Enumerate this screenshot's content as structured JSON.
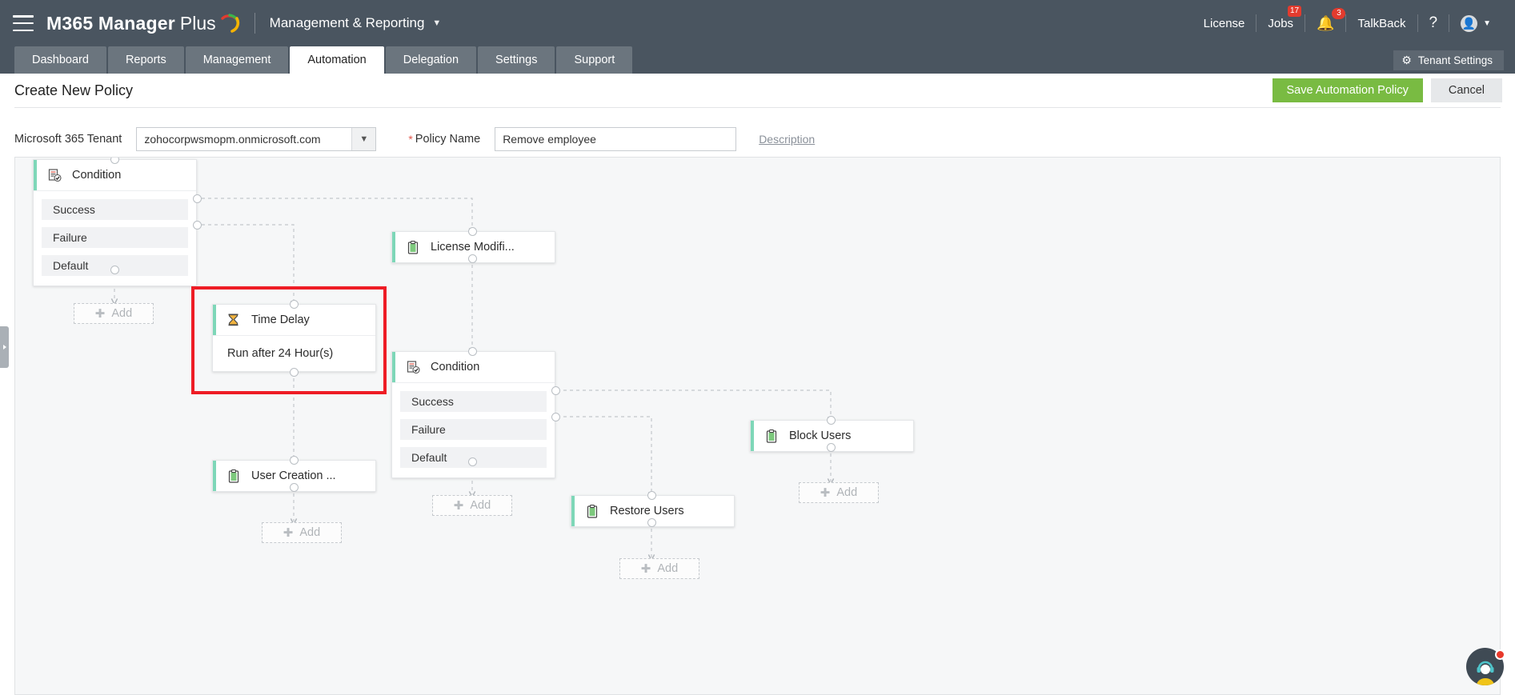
{
  "header": {
    "brand_bold": "M365 Manager",
    "brand_light": "Plus",
    "mode_selector": "Management & Reporting",
    "license": "License",
    "jobs": "Jobs",
    "jobs_badge": "17",
    "notifications_badge": "3",
    "talkback": "TalkBack",
    "help": "?",
    "menu_icon": "hamburger-icon",
    "bell_icon": "bell-icon",
    "user_icon": "user-avatar-icon"
  },
  "tabs": [
    {
      "label": "Dashboard",
      "active": false
    },
    {
      "label": "Reports",
      "active": false
    },
    {
      "label": "Management",
      "active": false
    },
    {
      "label": "Automation",
      "active": true
    },
    {
      "label": "Delegation",
      "active": false
    },
    {
      "label": "Settings",
      "active": false
    },
    {
      "label": "Support",
      "active": false
    }
  ],
  "tenant_settings": {
    "label": "Tenant Settings",
    "icon": "gear-icon"
  },
  "toolbar": {
    "page_title": "Create New Policy",
    "save_label": "Save Automation Policy",
    "cancel_label": "Cancel",
    "save_color": "#79bb42"
  },
  "form": {
    "tenant_label": "Microsoft 365 Tenant",
    "tenant_value": "zohocorpwsmopm.onmicrosoft.com",
    "required_mark": "*",
    "policy_name_label": "Policy Name",
    "policy_name_value": "Remove employee",
    "policy_name_placeholder": "Policy Name",
    "description_link": "Description"
  },
  "canvas": {
    "accent_color": "#7ed7b8",
    "highlight_color": "#ee1c25",
    "add_label": "Add",
    "nodes": [
      {
        "id": "condition1",
        "title": "Condition",
        "icon": "condition-icon",
        "branches": [
          "Success",
          "Failure",
          "Default"
        ]
      },
      {
        "id": "time_delay",
        "title": "Time Delay",
        "icon": "hourglass-icon",
        "detail": "Run after 24 Hour(s)",
        "highlighted": true
      },
      {
        "id": "license_modification",
        "title": "License Modifi...",
        "icon": "clipboard-icon"
      },
      {
        "id": "condition2",
        "title": "Condition",
        "icon": "condition-icon",
        "branches": [
          "Success",
          "Failure",
          "Default"
        ]
      },
      {
        "id": "user_creation",
        "title": "User Creation ...",
        "icon": "clipboard-icon"
      },
      {
        "id": "block_users",
        "title": "Block Users",
        "icon": "clipboard-icon"
      },
      {
        "id": "restore_users",
        "title": "Restore Users",
        "icon": "clipboard-icon"
      }
    ],
    "add_buttons": [
      {
        "id": "add_under_condition1"
      },
      {
        "id": "add_under_user_creation"
      },
      {
        "id": "add_under_condition2"
      },
      {
        "id": "add_under_block_users"
      },
      {
        "id": "add_under_restore_users"
      }
    ]
  },
  "chat": {
    "icon": "support-agent-icon",
    "has_notification": true
  }
}
